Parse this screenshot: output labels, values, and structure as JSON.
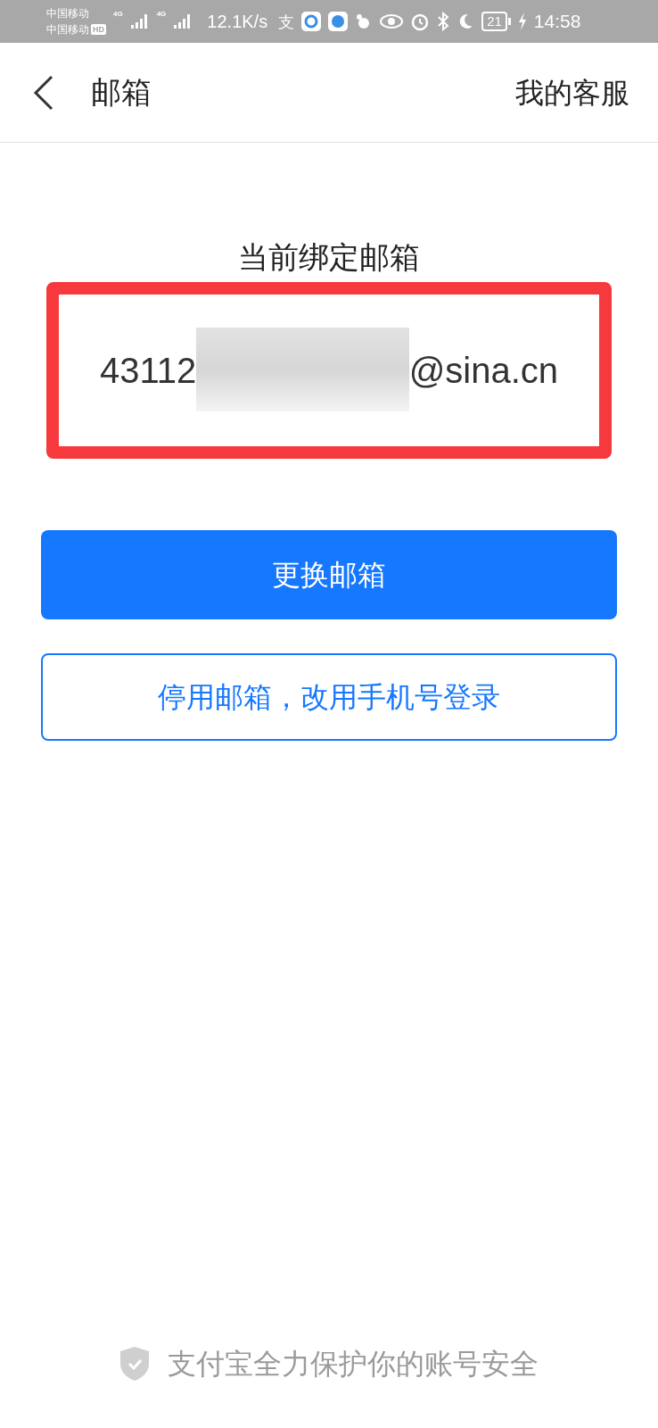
{
  "status_bar": {
    "carrier_1": "中国移动",
    "carrier_2": "中国移动",
    "hd": "HD",
    "network_1": "4G",
    "network_2": "4G",
    "speed": "12.1K/s",
    "alipay_glyph": "支",
    "battery": "21",
    "time": "14:58"
  },
  "header": {
    "title": "邮箱",
    "action": "我的客服"
  },
  "current_email": {
    "label": "当前绑定邮箱",
    "visible_start": "43112",
    "visible_end": "@sina.cn",
    "highlighted": true
  },
  "buttons": [
    {
      "kind": "primary",
      "label": "更换邮箱"
    },
    {
      "kind": "outline",
      "label": "停用邮箱，改用手机号登录"
    }
  ],
  "footer": {
    "text": "支付宝全力保护你的账号安全"
  }
}
